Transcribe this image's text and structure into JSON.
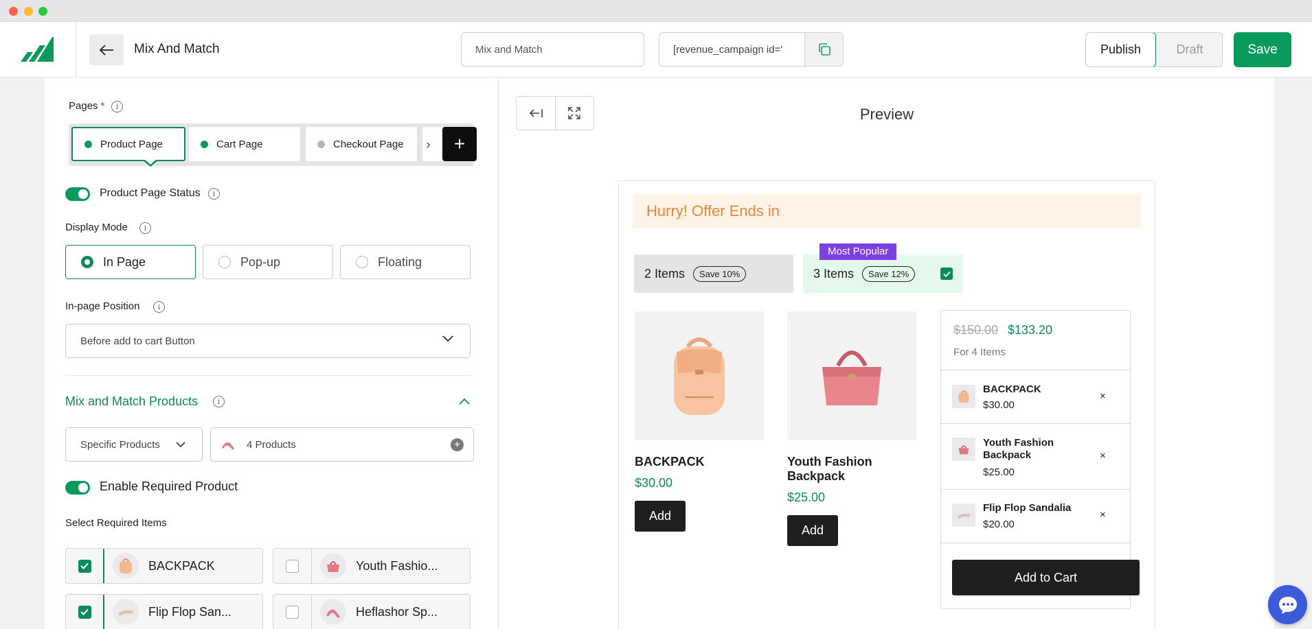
{
  "header": {
    "title": "Mix And Match",
    "campaign_name": "Mix and Match",
    "shortcode": "[revenue_campaign id='",
    "publish_label": "Publish",
    "draft_label": "Draft",
    "save_label": "Save"
  },
  "settings": {
    "pages_label": "Pages",
    "required_mark": "*",
    "page_tabs": [
      {
        "label": "Product Page",
        "dot_color": "#0c9a5c"
      },
      {
        "label": "Cart Page",
        "dot_color": "#0c9a5c"
      },
      {
        "label": "Checkout Page",
        "dot_color": "#b5b5b8"
      }
    ],
    "add_page_label": "+",
    "status_label": "Product Page Status",
    "display_mode_label": "Display Mode",
    "display_modes": [
      "In Page",
      "Pop-up",
      "Floating"
    ],
    "position_label": "In-page Position",
    "position_value": "Before add to cart Button",
    "section_title": "Mix and Match Products",
    "product_filter": "Specific Products",
    "product_count": "4 Products",
    "required_toggle_label": "Enable Required Product",
    "select_required_label": "Select Required Items",
    "required_items": [
      {
        "name": "BACKPACK",
        "checked": true,
        "icon": "backpack-icon"
      },
      {
        "name": "Youth Fashio...",
        "checked": false,
        "icon": "handbag-icon"
      },
      {
        "name": "Flip Flop San...",
        "checked": true,
        "icon": "sandal-icon"
      },
      {
        "name": "Heflashor Sp...",
        "checked": false,
        "icon": "heel-icon"
      }
    ]
  },
  "preview": {
    "title": "Preview",
    "offer_banner": "Hurry! Offer Ends in",
    "quantity_options": [
      {
        "label": "2 Items",
        "save": "Save 10%"
      },
      {
        "label": "3 Items",
        "save": "Save 12%"
      }
    ],
    "popular_badge": "Most Popular",
    "products": [
      {
        "name": "BACKPACK",
        "price": "$30.00",
        "button": "Add"
      },
      {
        "name": "Youth Fashion Backpack",
        "price": "$25.00",
        "button": "Add"
      }
    ],
    "summary": {
      "old_price": "$150.00",
      "new_price": "$133.20",
      "for_items": "For 4 Items",
      "items": [
        {
          "name": "BACKPACK",
          "price": "$30.00"
        },
        {
          "name": "Youth Fashion Backpack",
          "price": "$25.00"
        },
        {
          "name": "Flip Flop Sandalia",
          "price": "$20.00"
        }
      ],
      "remove_glyph": "×",
      "cart_button": "Add to Cart"
    }
  },
  "colors": {
    "brand_green": "#0a9a5c",
    "accent_purple": "#7b3fe4",
    "offer_orange": "#e8883a"
  }
}
